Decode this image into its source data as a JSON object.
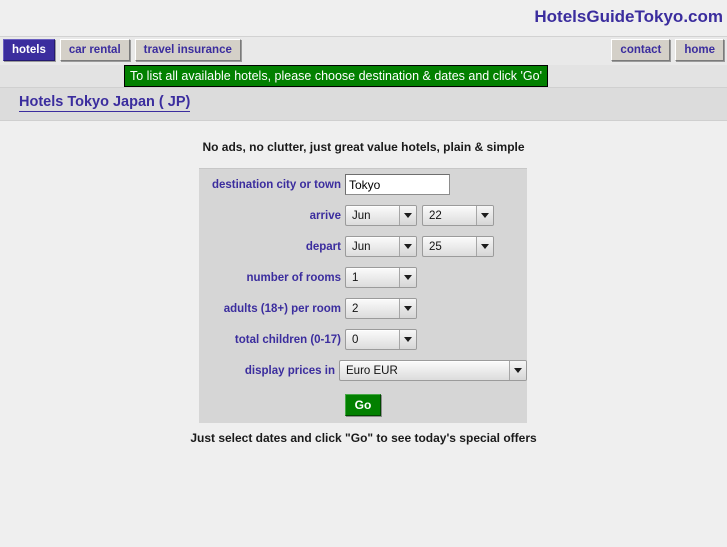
{
  "site": {
    "brand_title": "HotelsGuideTokyo.com"
  },
  "nav": {
    "left_tabs": [
      {
        "label": "hotels",
        "active": true
      },
      {
        "label": "car rental",
        "active": false
      },
      {
        "label": "travel insurance",
        "active": false
      }
    ],
    "right_tabs": [
      {
        "label": "contact"
      },
      {
        "label": "home"
      }
    ]
  },
  "notice": {
    "text": "To list all available hotels, please choose destination & dates and click 'Go'",
    "background_color": "#028000",
    "text_color": "#ffffff"
  },
  "page": {
    "title": "Hotels Tokyo Japan ( JP)",
    "title_color": "#3b2d9e",
    "tagline": "No ads, no clutter, just great value hotels, plain & simple",
    "footnote": "Just select dates and click \"Go\" to see today's special offers"
  },
  "form": {
    "destination": {
      "label": "destination city or town",
      "value": "Tokyo",
      "placeholder": ""
    },
    "arrive": {
      "label": "arrive",
      "month": "Jun",
      "day": "22"
    },
    "depart": {
      "label": "depart",
      "month": "Jun",
      "day": "25"
    },
    "rooms": {
      "label": "number of rooms",
      "value": "1"
    },
    "adults": {
      "label": "adults (18+) per room",
      "value": "2"
    },
    "children": {
      "label": "total children (0-17)",
      "value": "0"
    },
    "currency": {
      "label": "display prices in",
      "value": "Euro EUR"
    },
    "submit": {
      "label": "Go",
      "color": "#028000"
    }
  }
}
